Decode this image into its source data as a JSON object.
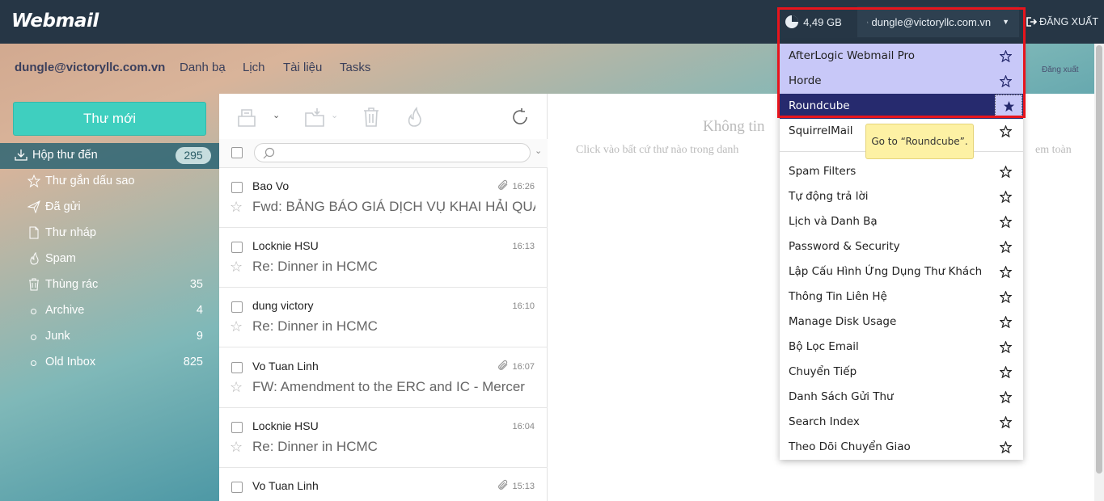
{
  "app": {
    "logo": "Webmail"
  },
  "topbar": {
    "disk_usage": "4,49 GB",
    "user": "dungle@victoryllc.com.vn",
    "logout": "ĐĂNG XUẤT"
  },
  "nav": {
    "account": "dungle@victoryllc.com.vn",
    "links": [
      "Danh bạ",
      "Lịch",
      "Tài liệu",
      "Tasks"
    ],
    "logout_small": "Đăng xuất"
  },
  "compose_label": "Thư mới",
  "folders": [
    {
      "name": "Hộp thư đến",
      "count": "295",
      "icon": "inbox-icon"
    },
    {
      "name": "Thư gắn dấu sao",
      "count": "",
      "icon": "star-icon"
    },
    {
      "name": "Đã gửi",
      "count": "",
      "icon": "send-icon"
    },
    {
      "name": "Thư nháp",
      "count": "",
      "icon": "draft-icon"
    },
    {
      "name": "Spam",
      "count": "",
      "icon": "fire-icon"
    },
    {
      "name": "Thùng rác",
      "count": "35",
      "icon": "trash-icon"
    },
    {
      "name": "Archive",
      "count": "4",
      "icon": "circle-icon"
    },
    {
      "name": "Junk",
      "count": "9",
      "icon": "circle-icon"
    },
    {
      "name": "Old Inbox",
      "count": "825",
      "icon": "circle-icon"
    }
  ],
  "messages": [
    {
      "from": "Bao Vo",
      "time": "16:26",
      "attachment": true,
      "subject": "Fwd: BẢNG BÁO GIÁ DỊCH VỤ KHAI HẢI QUAN"
    },
    {
      "from": "Locknie HSU",
      "time": "16:13",
      "attachment": false,
      "subject": "Re: Dinner in HCMC"
    },
    {
      "from": "dung victory",
      "time": "16:10",
      "attachment": false,
      "subject": "Re: Dinner in HCMC"
    },
    {
      "from": "Vo Tuan Linh",
      "time": "16:07",
      "attachment": true,
      "subject": "FW: Amendment to the ERC and IC - Mercer"
    },
    {
      "from": "Locknie HSU",
      "time": "16:04",
      "attachment": false,
      "subject": "Re: Dinner in HCMC"
    },
    {
      "from": "Vo Tuan Linh",
      "time": "15:13",
      "attachment": true,
      "subject": ""
    }
  ],
  "preview": {
    "title": "Không tin",
    "hint": "Click vào bất cứ thư nào trong danh",
    "hint_tail": "em toàn"
  },
  "dropdown": {
    "apps": [
      "AfterLogic Webmail Pro",
      "Horde",
      "Roundcube",
      "SquirrelMail"
    ],
    "settings": [
      "Spam Filters",
      "Tự động trả lời",
      "Lịch và Danh Bạ",
      "Password & Security",
      "Lập Cấu Hình Ứng Dụng Thư Khách",
      "Thông Tin Liên Hệ",
      "Manage Disk Usage",
      "Bộ Lọc Email",
      "Chuyển Tiếp",
      "Danh Sách Gửi Thư",
      "Search Index",
      "Theo Dõi Chuyển Giao"
    ]
  },
  "tooltip": "Go to “Roundcube”.",
  "colors": {
    "topbar": "#263645",
    "compose": "#3fcfbf",
    "selected_item": "#262a6e",
    "highlight_item": "#c8c8f8",
    "annotation": "#e8141c"
  }
}
